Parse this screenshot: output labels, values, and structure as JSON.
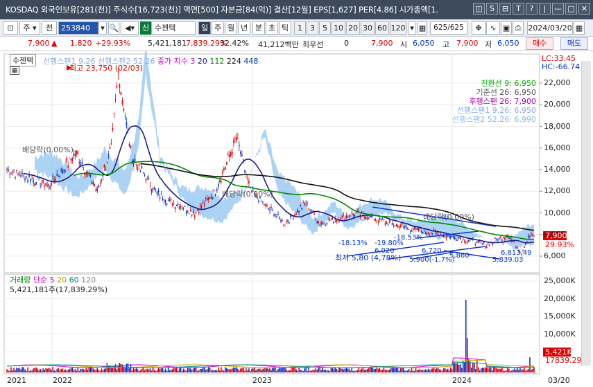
{
  "titlebar": {
    "title": "KOSDAQ 외국인보유[281(천)] 주식수[16,723(천)] 액면[500] 자본금[84(억)] 결산[12월] EPS[1,627] PER[4.86] 시가총액[1.",
    "controls": [
      "◫",
      "S",
      "⊟",
      "T",
      "?",
      "|",
      "—",
      "□",
      "✕"
    ]
  },
  "toolbar": {
    "market_type": "주",
    "view": "전",
    "code": "253840",
    "stock_badge": "신",
    "stock_name": "수젠텍",
    "periods": [
      "일",
      "주",
      "월",
      "년",
      "분",
      "초",
      "틱"
    ],
    "intervals": [
      "1",
      "3",
      "5",
      "10",
      "20",
      "30",
      "60",
      "120"
    ],
    "count": "625",
    "count_total": "/625",
    "date": "2024/03/20"
  },
  "quote": {
    "price": "7,900",
    "change": "1,820",
    "change_pct": "+29.93%",
    "volume": "5,421,181",
    "vol_ratio": "7,839.29%",
    "turnover": "32.42%",
    "amount": "41,212백만",
    "pref_label": "최우선",
    "pref_value": "0",
    "pref_price": "7,900",
    "open_label": "시",
    "open": "6,050",
    "high_label": "고",
    "high": "7,900",
    "low_label": "저",
    "low": "6,050",
    "buy": "매수",
    "sell": "매도"
  },
  "price_pane": {
    "label": "수젠텍",
    "legend": [
      "선행스팬1 9,26",
      "선행스팬2 52,26",
      "종가 지수 3",
      "20",
      "112",
      "224",
      "448"
    ],
    "lc": "LC:33.45",
    "hc": "HC:-66.74",
    "ichimoku": [
      {
        "label": "전환선 9: 6,950",
        "color": "#00aa00"
      },
      {
        "label": "기준선 26: 6,950",
        "color": "#555555"
      },
      {
        "label": "후행스팬 26: 7,900",
        "color": "#aa00aa"
      },
      {
        "label": "선행스팬1 9,26: 6,950",
        "color": "#88aaee"
      },
      {
        "label": "선행스팬2 52,26: 6,990",
        "color": "#88bbee"
      }
    ],
    "yticks": [
      "22,000",
      "20,000",
      "18,000",
      "16,000",
      "14,000",
      "12,000",
      "10,000",
      "8,000",
      "6,000"
    ],
    "annotations": {
      "max": "최고 23,750 (02/03)",
      "div1": "배당락(0.00%)",
      "div2": "배당락(0.00%)",
      "div3": "배당락(0.00%)",
      "min": "최저 5,80 (4,78%)",
      "pct_a": "-18.13%",
      "pct_b": "-19.80%",
      "pct_c": "-18.53%",
      "val_a": "6,020",
      "val_b": "6,720",
      "val_c": "5,860",
      "val_d": "6,813.49",
      "val_e": "5,839.03",
      "val_f": "5,900(-1.7%)"
    },
    "last_price": "7,900",
    "last_pct": "29.93%"
  },
  "volume_pane": {
    "label": "거래량",
    "legend": [
      "단순 5",
      "20",
      "60",
      "120"
    ],
    "value": "5,421,181주(17,839.29%)",
    "yticks": [
      "25,000K",
      "20,000K",
      "15,000K",
      "10,000K",
      "5,000K"
    ],
    "last": "5,421K",
    "last_pct": "17839.29"
  },
  "x_axis": [
    "2021",
    "2022",
    "2023",
    "2024",
    "03/20"
  ],
  "colors": {
    "up": "#e00000",
    "down": "#0033cc",
    "cloud": "#90c4f0",
    "ma20": "#1a1a8a",
    "ma112": "#008800",
    "ma224": "#111111"
  }
}
